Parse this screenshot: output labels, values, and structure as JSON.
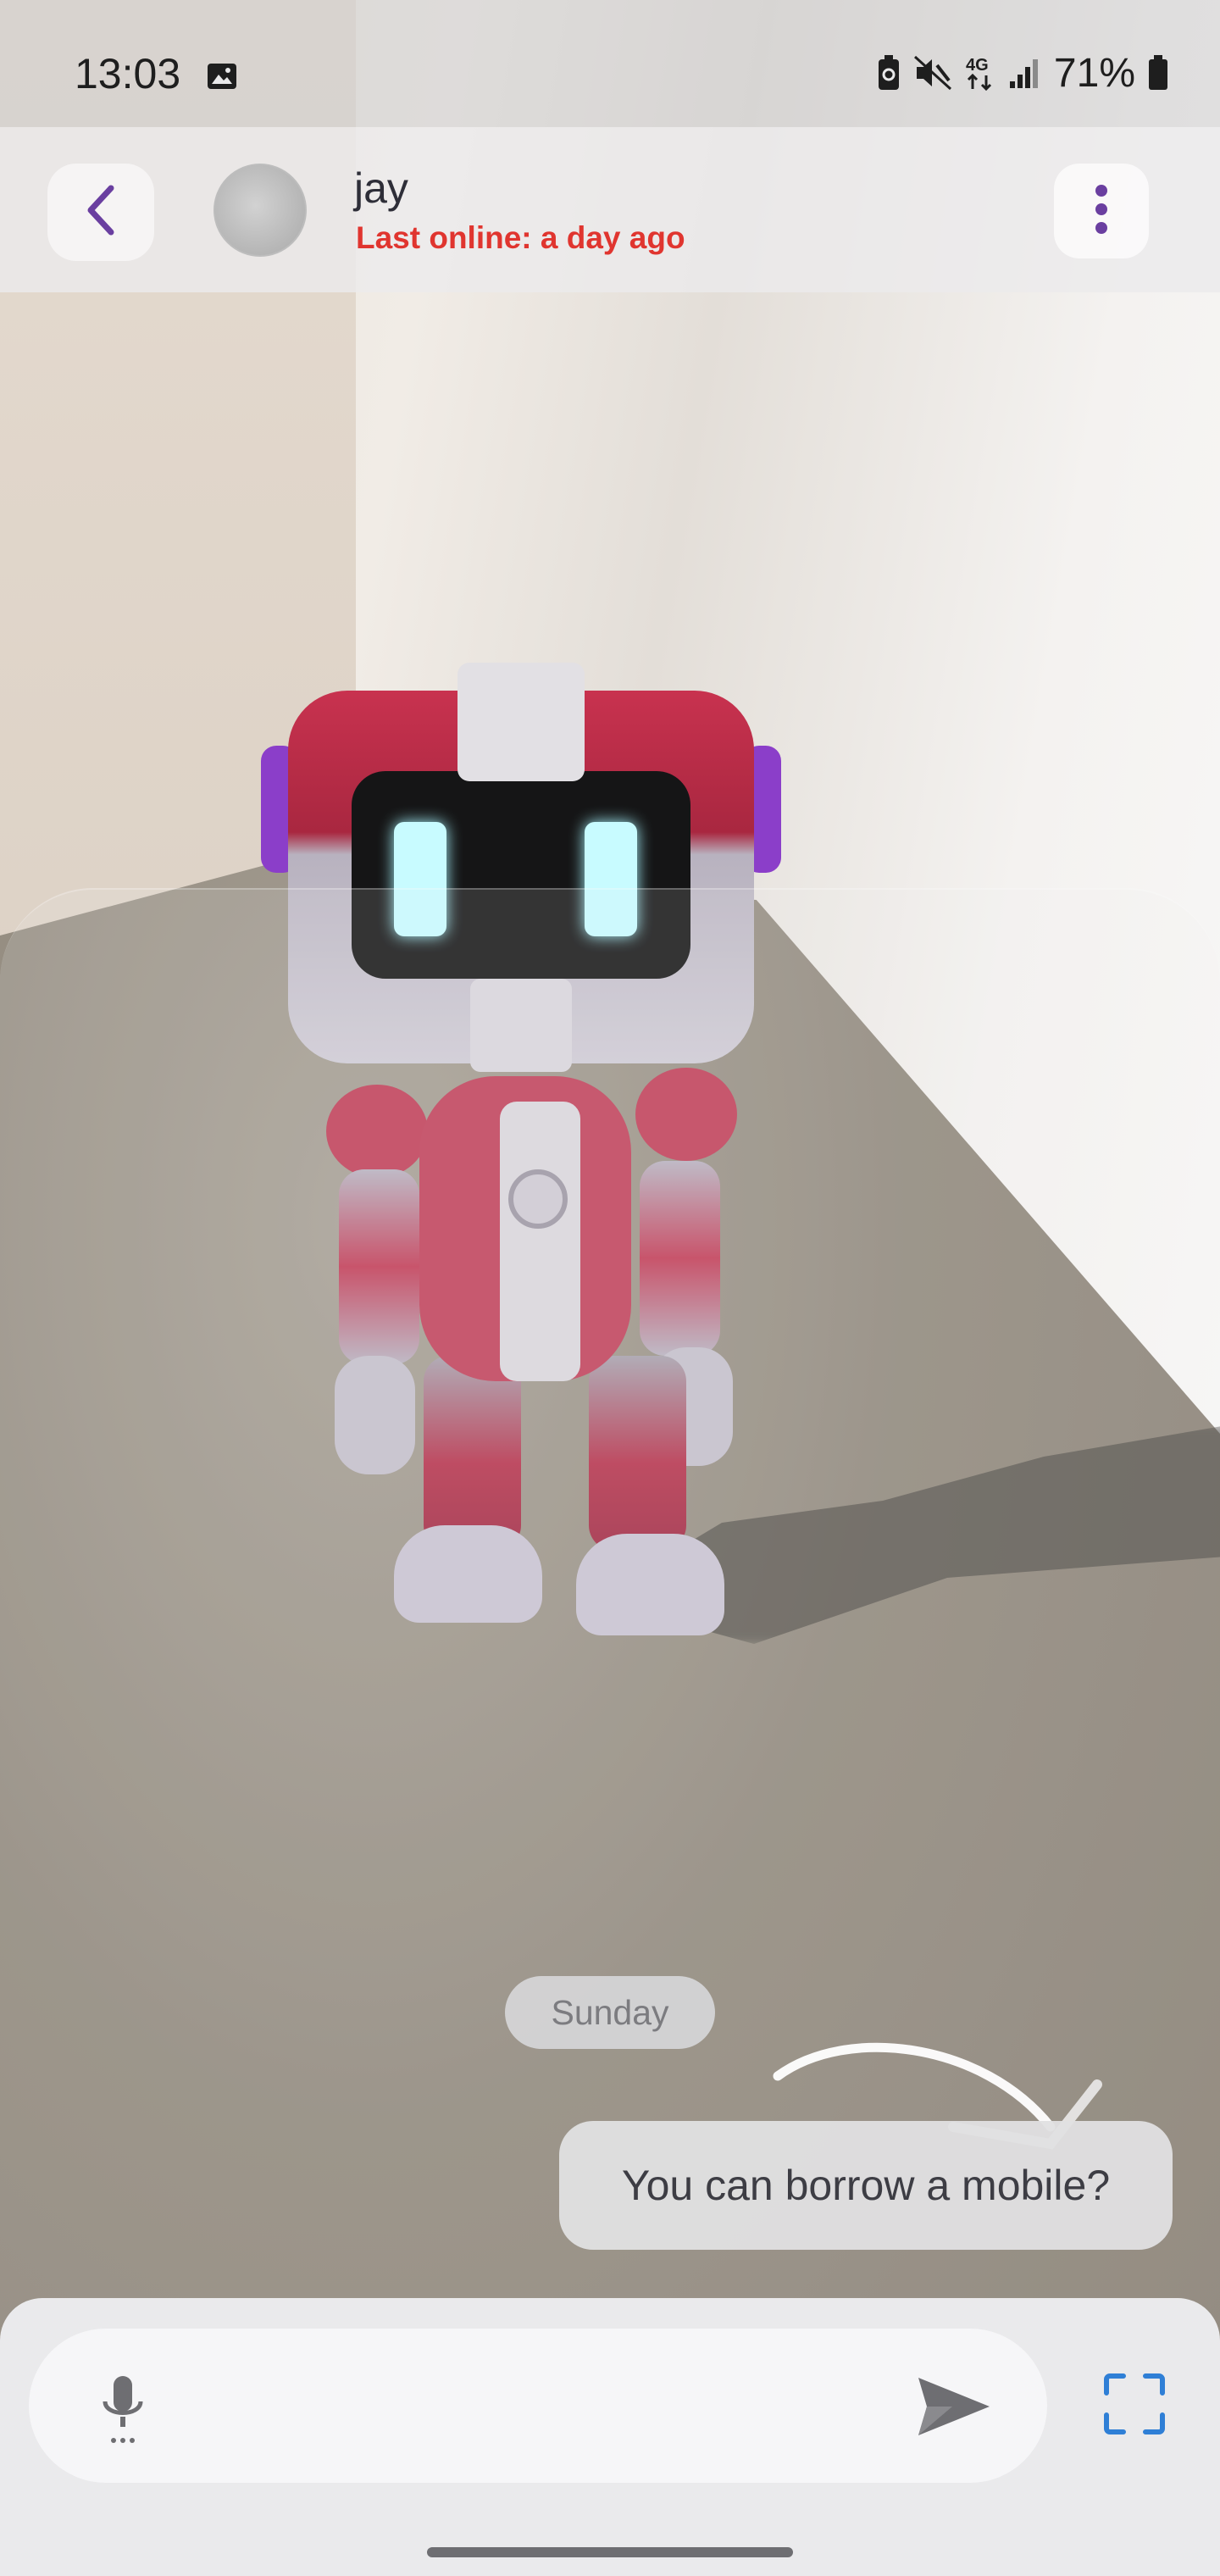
{
  "status_bar": {
    "time": "13:03",
    "network": "4G",
    "battery": "71%",
    "icons": [
      "image-icon",
      "battery-saver-icon",
      "mute-icon",
      "network-4g-icon",
      "signal-icon",
      "battery-icon"
    ]
  },
  "header": {
    "contact_name": "jay",
    "last_online": "Last online: a day ago",
    "back_icon": "chevron-left-icon",
    "menu_icon": "more-vert-icon"
  },
  "chat": {
    "day_separator": "Sunday",
    "messages": [
      {
        "text": "You can borrow a mobile?",
        "side": "sent"
      }
    ]
  },
  "composer": {
    "placeholder": "",
    "mic_icon": "mic-icon",
    "send_icon": "send-icon",
    "scan_icon": "scan-frame-icon"
  },
  "colors": {
    "accent": "#6a3fa0",
    "status_red": "#e0352f",
    "scan_blue": "#2f7fd6"
  }
}
